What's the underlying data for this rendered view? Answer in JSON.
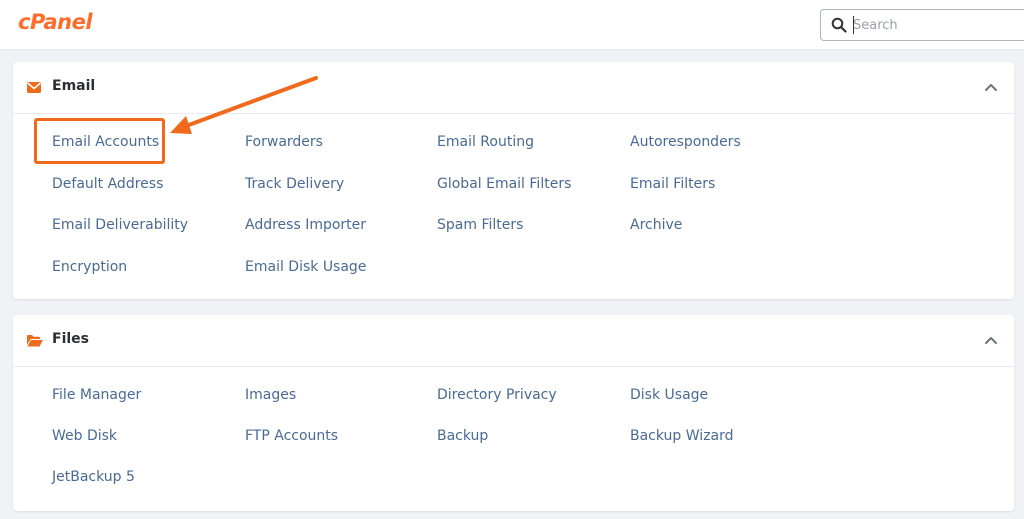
{
  "header": {
    "logo_text": "cPanel",
    "search_placeholder": "Search",
    "search_icon": "magnifier-icon"
  },
  "colors": {
    "brand": "#ff6c2c",
    "link": "#4a6a94",
    "annotation": "#f06a1e"
  },
  "sections": [
    {
      "title": "Email",
      "icon": "envelope-icon",
      "items": [
        "Email Accounts",
        "Forwarders",
        "Email Routing",
        "Autoresponders",
        "Default Address",
        "Track Delivery",
        "Global Email Filters",
        "Email Filters",
        "Email Deliverability",
        "Address Importer",
        "Spam Filters",
        "Archive",
        "Encryption",
        "Email Disk Usage"
      ]
    },
    {
      "title": "Files",
      "icon": "folder-open-icon",
      "items": [
        "File Manager",
        "Images",
        "Directory Privacy",
        "Disk Usage",
        "Web Disk",
        "FTP Accounts",
        "Backup",
        "Backup Wizard",
        "JetBackup 5"
      ]
    }
  ]
}
